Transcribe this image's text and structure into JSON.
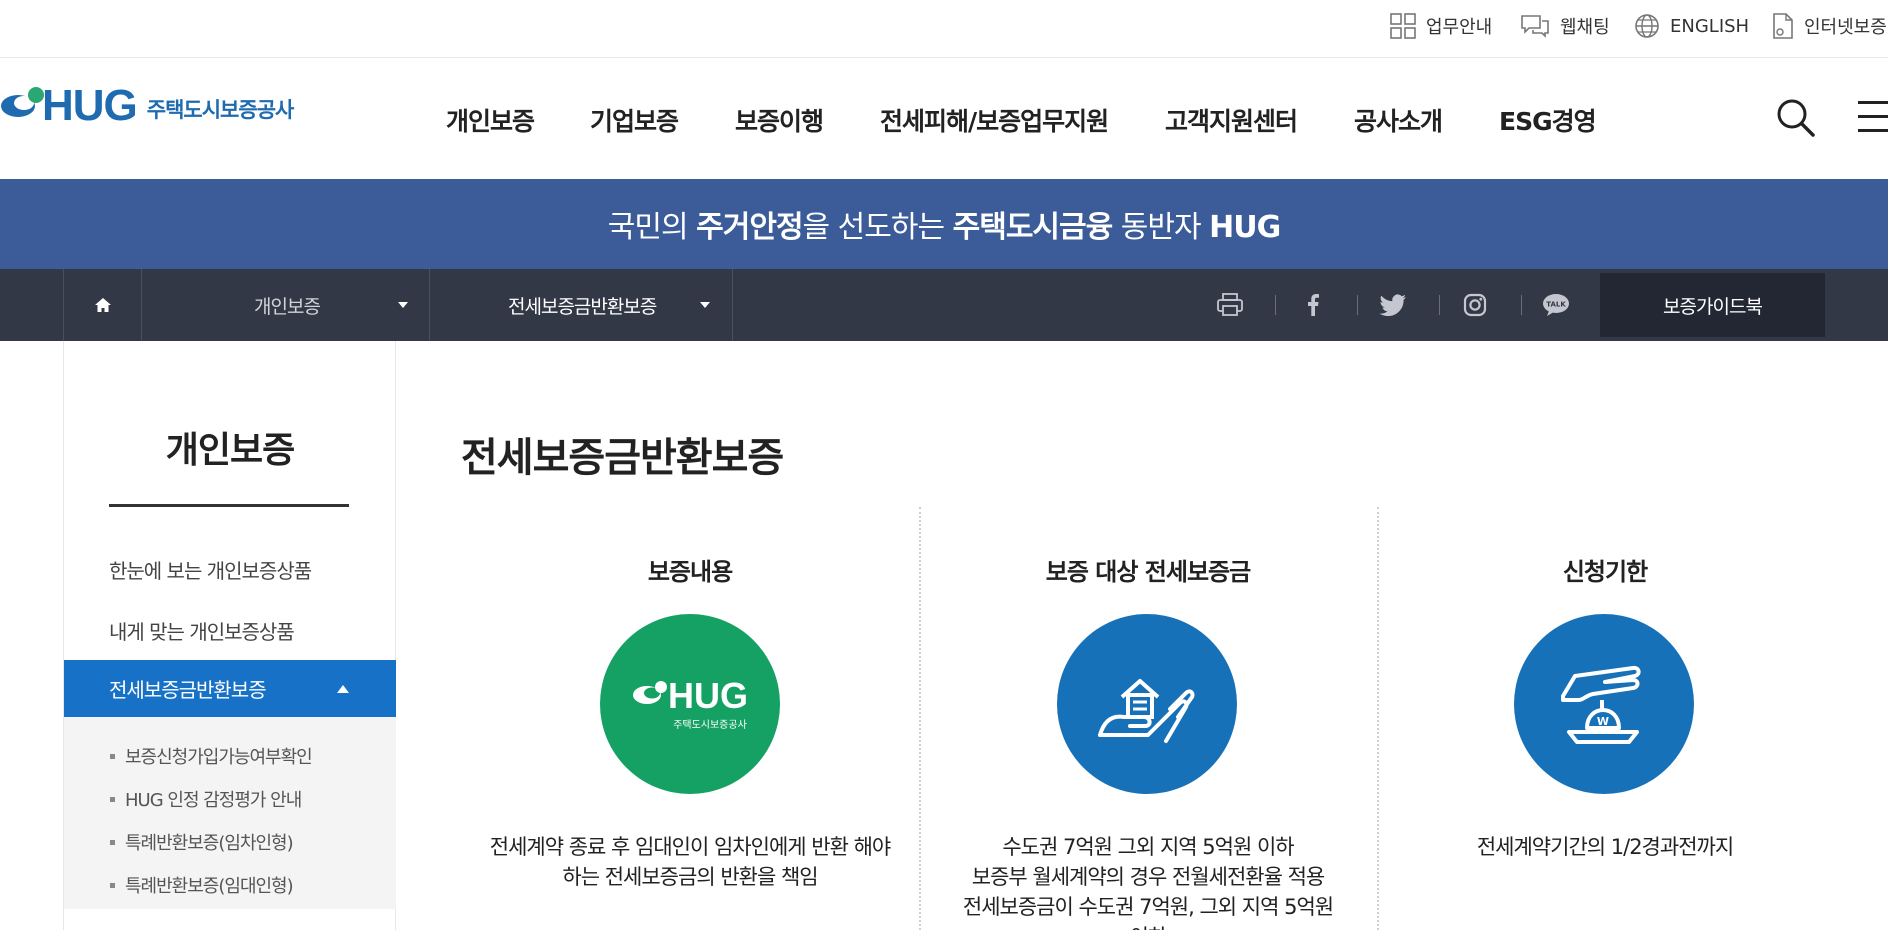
{
  "topbar": {
    "items": [
      {
        "label": "업무안내",
        "icon": "grid-icon"
      },
      {
        "label": "웹채팅",
        "icon": "chat-bubbles-icon"
      },
      {
        "label": "ENGLISH",
        "icon": "globe-icon"
      },
      {
        "label": "인터넷보증",
        "icon": "document-icon"
      }
    ]
  },
  "header": {
    "logo": {
      "hug": "HUG",
      "korean": "주택도시보증공사"
    },
    "menu": [
      "개인보증",
      "기업보증",
      "보증이행",
      "전세피해/보증업무지원",
      "고객지원센터",
      "공사소개",
      "ESG경영"
    ],
    "search_icon": "search-icon",
    "menu_icon": "hamburger-icon"
  },
  "banner": {
    "part1": "국민의 ",
    "bold1": "주거안정",
    "part2": "을 선도하는 ",
    "bold2": "주택도시금융",
    "part3": " 동반자 ",
    "bold3": "HUG"
  },
  "location": {
    "home_icon": "home-icon",
    "depth1": "개인보증",
    "depth2": "전세보증금반환보증",
    "sns_icons": [
      "print-icon",
      "facebook-icon",
      "twitter-icon",
      "instagram-icon",
      "kakaotalk-icon"
    ],
    "guide_button": "보증가이드북"
  },
  "sidebar": {
    "title": "개인보증",
    "items": [
      "한눈에 보는 개인보증상품",
      "내게 맞는 개인보증상품"
    ],
    "active": "전세보증금반환보증",
    "subitems": [
      "보증신청가입가능여부확인",
      "HUG 인정 감정평가 안내",
      "특례반환보증(임차인형)",
      "특례반환보증(임대인형)"
    ]
  },
  "content": {
    "title": "전세보증금반환보증",
    "columns": [
      {
        "heading": "보증내용",
        "circle_color": "#14a163",
        "icon": "hug-logo-icon",
        "logo_text": "HUG",
        "logo_sub": "주택도시보증공사",
        "lines": [
          "전세계약 종료 후 임대인이 임차인에게 반환 해야",
          "하는 전세보증금의 반환을 책임"
        ]
      },
      {
        "heading": "보증 대상 전세보증금",
        "circle_color": "#1771b8",
        "icon": "house-in-hand-icon",
        "lines": [
          "수도권 7억원 그외 지역 5억원 이하",
          "보증부 월세계약의 경우 전월세전환율 적용",
          "전세보증금이 수도권 7억원, 그외 지역 5억원",
          "이하"
        ]
      },
      {
        "heading": "신청기한",
        "circle_color": "#1771b8",
        "icon": "hand-money-bag-icon",
        "lines": [
          "전세계약기간의 1/2경과전까지"
        ]
      }
    ]
  }
}
